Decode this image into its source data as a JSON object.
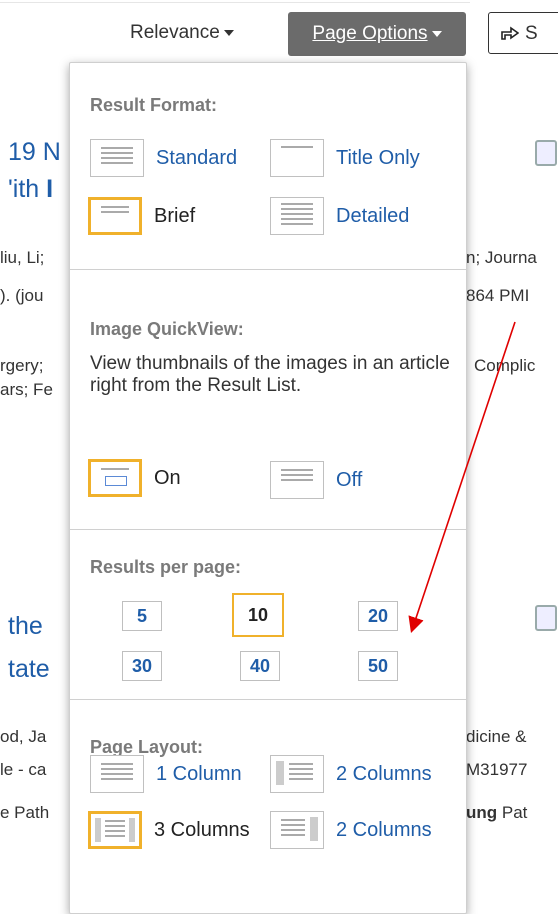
{
  "toolbar": {
    "relevance_label": "Relevance",
    "page_options_label": "Page Options",
    "share_label": "S"
  },
  "background": {
    "r1_title_a": "19 N",
    "r1_title_b": "'ith ",
    "r1_title_b_bold": "I",
    "r1_meta1_left": "liu, Li;",
    "r1_meta1_right": "n; Journa",
    "r1_meta2_left": "). (jou",
    "r1_meta2_right": "864 PMI",
    "r1_subj1_left": "rgery;",
    "r1_subj1_right": "Complic",
    "r1_subj2_left": "ars; Fe",
    "r2_title_a": "the",
    "r2_title_b": "tate",
    "r2_meta1_left": "od, Ja",
    "r2_meta1_right": "dicine &",
    "r2_meta2_left": "le - ca",
    "r2_meta2_right": "M31977",
    "r2_subj_left": "e Path",
    "r2_subj_right_bold": "ung",
    "r2_subj_right": " Pat"
  },
  "dropdown": {
    "result_format": {
      "title": "Result Format:",
      "options": [
        {
          "label": "Standard",
          "selected": false
        },
        {
          "label": "Title Only",
          "selected": false
        },
        {
          "label": "Brief",
          "selected": true
        },
        {
          "label": "Detailed",
          "selected": false
        }
      ]
    },
    "image_quickview": {
      "title": "Image QuickView:",
      "description": "View thumbnails of the images in an article right from the Result List.",
      "options": [
        {
          "label": "On",
          "selected": true
        },
        {
          "label": "Off",
          "selected": false
        }
      ]
    },
    "results_per_page": {
      "title": "Results per page:",
      "options": [
        "5",
        "10",
        "20",
        "30",
        "40",
        "50"
      ],
      "selected": "10"
    },
    "page_layout": {
      "title": "Page Layout:",
      "options": [
        {
          "label": "1 Column",
          "selected": false
        },
        {
          "label": "2 Columns",
          "selected": false
        },
        {
          "label": "3 Columns",
          "selected": true
        },
        {
          "label": "2 Columns",
          "selected": false
        }
      ]
    }
  },
  "colors": {
    "accent_link": "#1f5da8",
    "selected_border": "#f0b12b",
    "annotation_arrow": "#e00000",
    "button_dark": "#6b6b6b"
  }
}
